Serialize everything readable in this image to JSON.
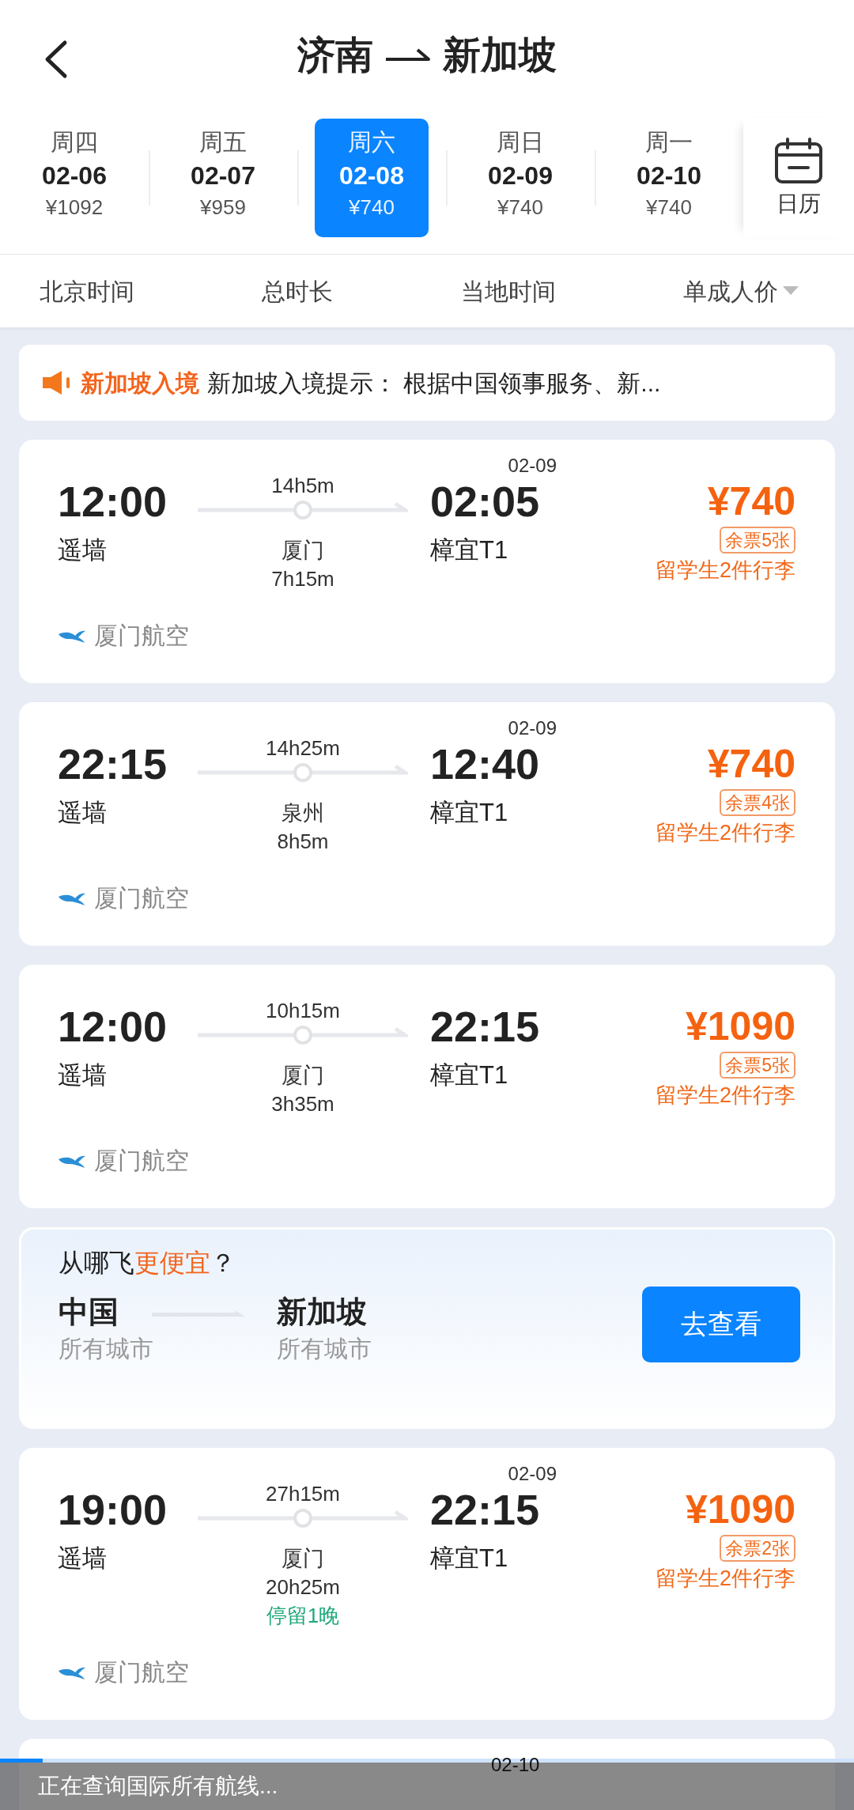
{
  "header": {
    "from": "济南",
    "to": "新加坡"
  },
  "dates": [
    {
      "weekday": "周四",
      "date": "02-06",
      "price": "¥1092",
      "selected": false
    },
    {
      "weekday": "周五",
      "date": "02-07",
      "price": "¥959",
      "selected": false
    },
    {
      "weekday": "周六",
      "date": "02-08",
      "price": "¥740",
      "selected": true
    },
    {
      "weekday": "周日",
      "date": "02-09",
      "price": "¥740",
      "selected": false
    },
    {
      "weekday": "周一",
      "date": "02-10",
      "price": "¥740",
      "selected": false
    }
  ],
  "calendar": {
    "label": "日历"
  },
  "sort_bar": [
    {
      "label": "北京时间",
      "kind": "plain"
    },
    {
      "label": "总时长",
      "kind": "plain"
    },
    {
      "label": "当地时间",
      "kind": "plain"
    },
    {
      "label": "单成人价",
      "kind": "dropdown"
    }
  ],
  "notice": {
    "tag": "新加坡入境",
    "text": "新加坡入境提示： 根据中国领事服务、新..."
  },
  "items": [
    {
      "kind": "flight",
      "dep_time": "12:00",
      "dep_airport": "遥墙",
      "duration": "14h5m",
      "stop_city": "厦门",
      "stop_duration": "7h15m",
      "arr_date": "02-09",
      "arr_time": "02:05",
      "arr_airport": "樟宜T1",
      "price": "¥740",
      "tickets": "余票5张",
      "baggage": "留学生2件行李",
      "airline": "厦门航空"
    },
    {
      "kind": "flight",
      "dep_time": "22:15",
      "dep_airport": "遥墙",
      "duration": "14h25m",
      "stop_city": "泉州",
      "stop_duration": "8h5m",
      "arr_date": "02-09",
      "arr_time": "12:40",
      "arr_airport": "樟宜T1",
      "price": "¥740",
      "tickets": "余票4张",
      "baggage": "留学生2件行李",
      "airline": "厦门航空"
    },
    {
      "kind": "flight",
      "dep_time": "12:00",
      "dep_airport": "遥墙",
      "duration": "10h15m",
      "stop_city": "厦门",
      "stop_duration": "3h35m",
      "arr_time": "22:15",
      "arr_airport": "樟宜T1",
      "price": "¥1090",
      "tickets": "余票5张",
      "baggage": "留学生2件行李",
      "airline": "厦门航空"
    },
    {
      "kind": "promo",
      "title": "从哪飞",
      "highlight": "更便宜",
      "title_end": "？",
      "from_place": "中国",
      "from_sub": "所有城市",
      "to_place": "新加坡",
      "to_sub": "所有城市",
      "button": "去查看"
    },
    {
      "kind": "flight",
      "dep_time": "19:00",
      "dep_airport": "遥墙",
      "duration": "27h15m",
      "stop_city": "厦门",
      "stop_duration": "20h25m",
      "stop_note": "停留1晚",
      "arr_date": "02-09",
      "arr_time": "22:15",
      "arr_airport": "樟宜T1",
      "price": "¥1090",
      "tickets": "余票2张",
      "baggage": "留学生2件行李",
      "airline": "厦门航空"
    },
    {
      "kind": "partial",
      "arr_date": "02-10"
    }
  ],
  "loading": {
    "text": "正在查询国际所有航线...",
    "level": 0.05
  }
}
